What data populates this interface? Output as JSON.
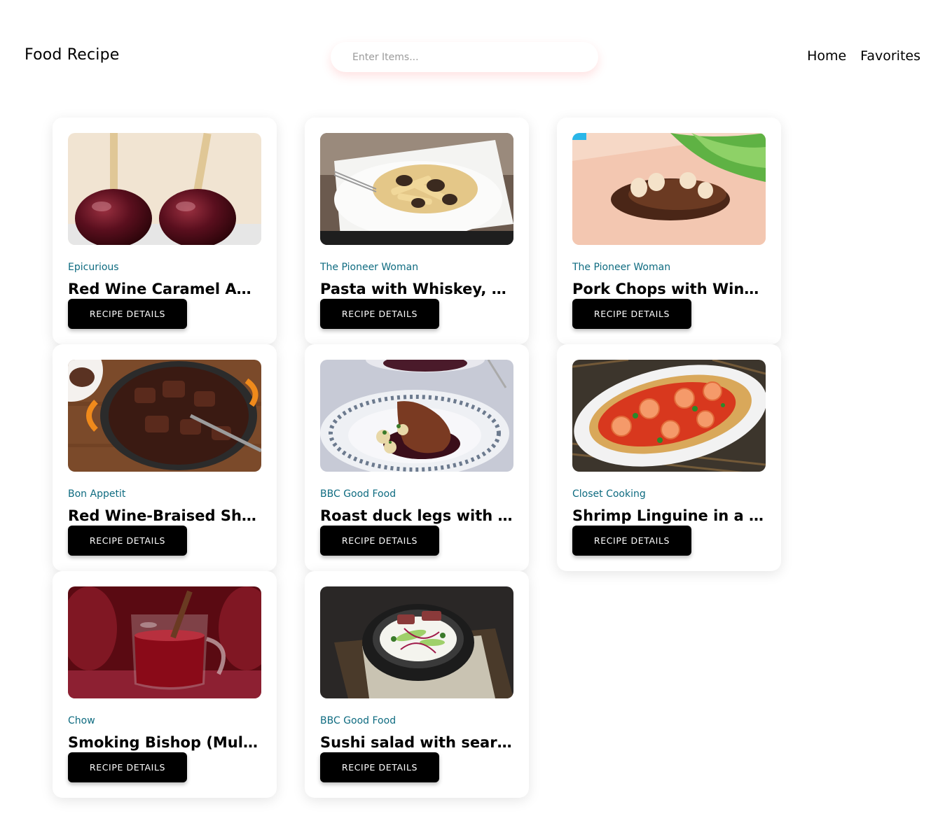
{
  "header": {
    "brand": "Food Recipe",
    "search_placeholder": "Enter Items...",
    "nav": [
      {
        "label": "Home"
      },
      {
        "label": "Favorites"
      }
    ]
  },
  "recipes": [
    {
      "publisher": "Epicurious",
      "title": "Red Wine Caramel Ap...",
      "button": "RECIPE DETAILS",
      "image": "caramel-apples-photo"
    },
    {
      "publisher": "The Pioneer Woman",
      "title": "Pasta with Whiskey, W...",
      "button": "RECIPE DETAILS",
      "image": "pasta-plate-photo"
    },
    {
      "publisher": "The Pioneer Woman",
      "title": "Pork Chops with Wine...",
      "button": "RECIPE DETAILS",
      "image": "pork-chops-photo"
    },
    {
      "publisher": "Bon Appetit",
      "title": "Red Wine-Braised Sho...",
      "button": "RECIPE DETAILS",
      "image": "braised-short-ribs-photo"
    },
    {
      "publisher": "BBC Good Food",
      "title": "Roast duck legs with r...",
      "button": "RECIPE DETAILS",
      "image": "roast-duck-photo"
    },
    {
      "publisher": "Closet Cooking",
      "title": "Shrimp Linguine in a T...",
      "button": "RECIPE DETAILS",
      "image": "shrimp-linguine-photo"
    },
    {
      "publisher": "Chow",
      "title": "Smoking Bishop (Mull...",
      "button": "RECIPE DETAILS",
      "image": "mulled-wine-photo"
    },
    {
      "publisher": "BBC Good Food",
      "title": "Sushi salad with seare...",
      "button": "RECIPE DETAILS",
      "image": "sushi-salad-photo"
    }
  ]
}
